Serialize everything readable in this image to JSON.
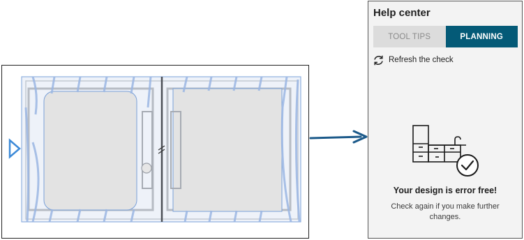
{
  "help_center": {
    "title": "Help center",
    "tabs": [
      {
        "label": "TOOL TIPS",
        "active": false
      },
      {
        "label": "PLANNING",
        "active": true
      }
    ],
    "refresh_label": "Refresh the check",
    "refresh_icon": "refresh-icon",
    "illustration_icon": "kitchen-cabinet-check-icon",
    "status_title": "Your design is error free!",
    "status_description": "Check again if you make further changes."
  },
  "canvas": {
    "object": "double-door-cabinet-plan",
    "selection_handle_icon": "triangle-right-icon",
    "selection_color": "#4a7fd0"
  },
  "colors": {
    "accent": "#045a77",
    "arrow": "#1c5a8a",
    "inactive_tab": "#dcdcdc",
    "panel_bg": "#f3f3f3"
  }
}
